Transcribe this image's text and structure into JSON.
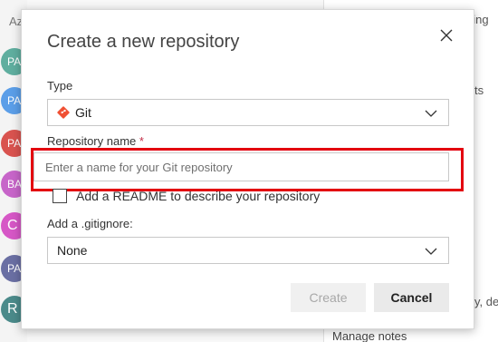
{
  "background": {
    "left_header": "Az",
    "avatars": [
      {
        "initials": "PA",
        "color": "#5fae9f"
      },
      {
        "initials": "PA",
        "color": "#5b9ee8"
      },
      {
        "initials": "PA",
        "color": "#d9534f"
      },
      {
        "initials": "BA",
        "color": "#c765c9"
      },
      {
        "initials": "C",
        "color": "#d657c6"
      },
      {
        "initials": "PA",
        "color": "#6a6fa3"
      },
      {
        "initials": "R",
        "color": "#4b8a8a"
      }
    ],
    "right_fragments": {
      "top": "ning",
      "middle": "ts",
      "lower": "y, de",
      "bottom": "Manage notes"
    }
  },
  "dialog": {
    "title": "Create a new repository",
    "type_label": "Type",
    "type_value": "Git",
    "repo_name_label": "Repository name",
    "required_mark": "*",
    "repo_name_placeholder": "Enter a name for your Git repository",
    "repo_name_value": "",
    "readme_label": "Add a README to describe your repository",
    "readme_checked": false,
    "gitignore_label": "Add a .gitignore:",
    "gitignore_value": "None",
    "create_label": "Create",
    "cancel_label": "Cancel"
  },
  "colors": {
    "highlight": "#e3000f",
    "git_brand": "#f05033"
  }
}
